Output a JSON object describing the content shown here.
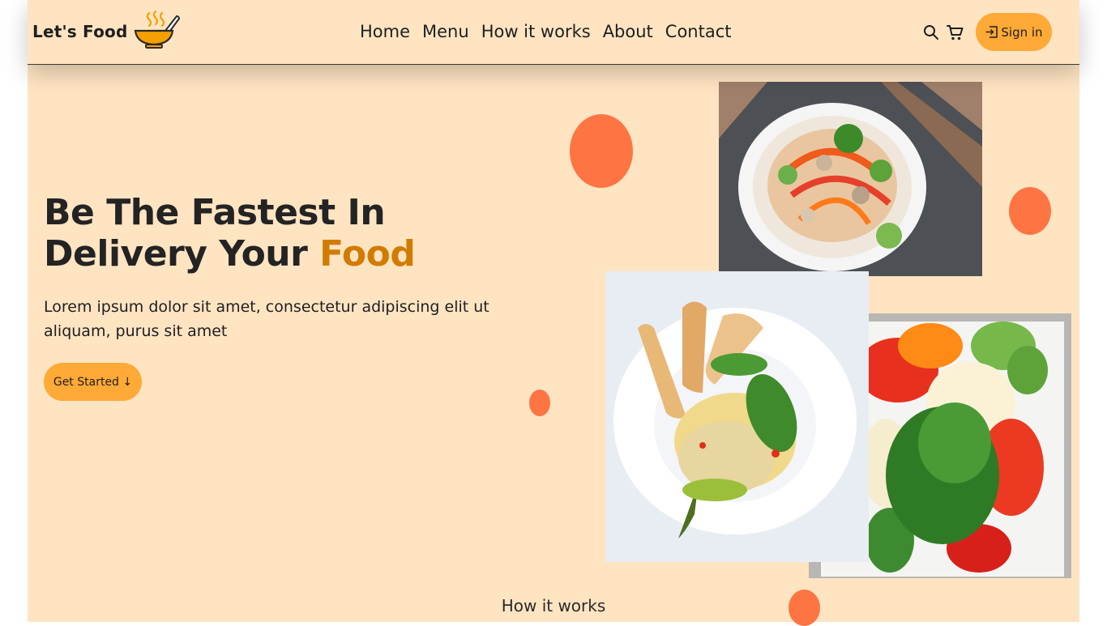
{
  "brand": {
    "name": "Let's Food",
    "logo_icon": "soup-bowl-icon"
  },
  "nav": {
    "items": [
      "Home",
      "Menu",
      "How it works",
      "About",
      "Contact"
    ]
  },
  "header_actions": {
    "search_icon": "search-icon",
    "cart_icon": "cart-icon",
    "signin_icon": "sign-in-icon",
    "signin_label": "Sign in"
  },
  "hero": {
    "title_line1": "Be The Fastest In",
    "title_line2": "Delivery Your",
    "title_accent": "Food",
    "text": "Lorem ipsum dolor sit amet, consectetur adipiscing elit ut aliquam, purus sit amet",
    "cta_label": "Get Started ↓"
  },
  "images": {
    "top": "noodle-salad-bowl-photo",
    "middle": "pasta-with-basil-photo",
    "right": "vegetable-platter-photo"
  },
  "section": {
    "title": "How it works"
  },
  "colors": {
    "background": "#ffe4c2",
    "accent": "#ffa937",
    "title_accent": "#d17c00",
    "blob": "#ff7443",
    "text": "#232323"
  }
}
